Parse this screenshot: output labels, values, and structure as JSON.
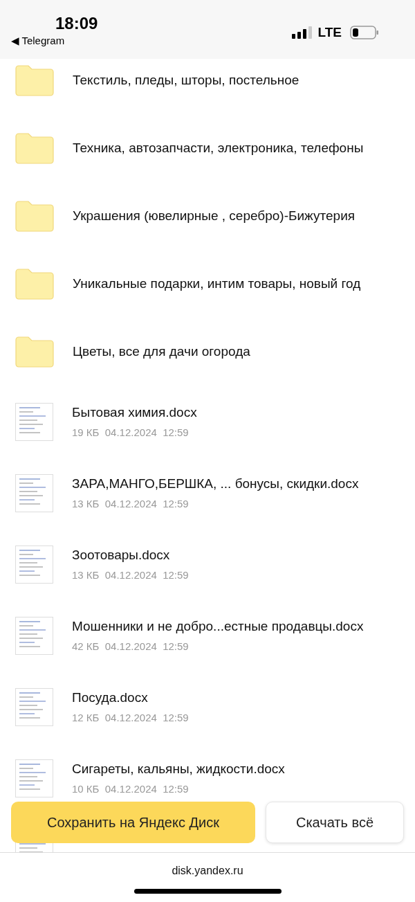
{
  "status_bar": {
    "time": "18:09",
    "back_link": "◀ Telegram",
    "network": "LTE"
  },
  "items": [
    {
      "kind": "folder",
      "name": "Текстиль, пледы, шторы, постельное"
    },
    {
      "kind": "folder",
      "name": "Техника, автозапчасти, электроника, телефоны"
    },
    {
      "kind": "folder",
      "name": "Украшения (ювелирные , серебро)-Бижутерия"
    },
    {
      "kind": "folder",
      "name": "Уникальные подарки, интим товары, новый год"
    },
    {
      "kind": "folder",
      "name": "Цветы, все для дачи огорода"
    },
    {
      "kind": "file",
      "name": "Бытовая химия.docx",
      "size": "19 КБ",
      "date": "04.12.2024",
      "time": "12:59"
    },
    {
      "kind": "file",
      "name": "ЗАРА,МАНГО,БЕРШКА, ... бонусы, скидки.docx",
      "size": "13 КБ",
      "date": "04.12.2024",
      "time": "12:59"
    },
    {
      "kind": "file",
      "name": "Зоотовары.docx",
      "size": "13 КБ",
      "date": "04.12.2024",
      "time": "12:59"
    },
    {
      "kind": "file",
      "name": "Мошенники и не добро...естные продавцы.docx",
      "size": "42 КБ",
      "date": "04.12.2024",
      "time": "12:59"
    },
    {
      "kind": "file",
      "name": "Посуда.docx",
      "size": "12 КБ",
      "date": "04.12.2024",
      "time": "12:59"
    },
    {
      "kind": "file",
      "name": "Сигареты, кальяны, жидкости.docx",
      "size": "10 КБ",
      "date": "04.12.2024",
      "time": "12:59"
    },
    {
      "kind": "file"
    }
  ],
  "actions": {
    "save": "Сохранить на Яндекс Диск",
    "download": "Скачать всё"
  },
  "browser_bar": {
    "url": "disk.yandex.ru"
  }
}
